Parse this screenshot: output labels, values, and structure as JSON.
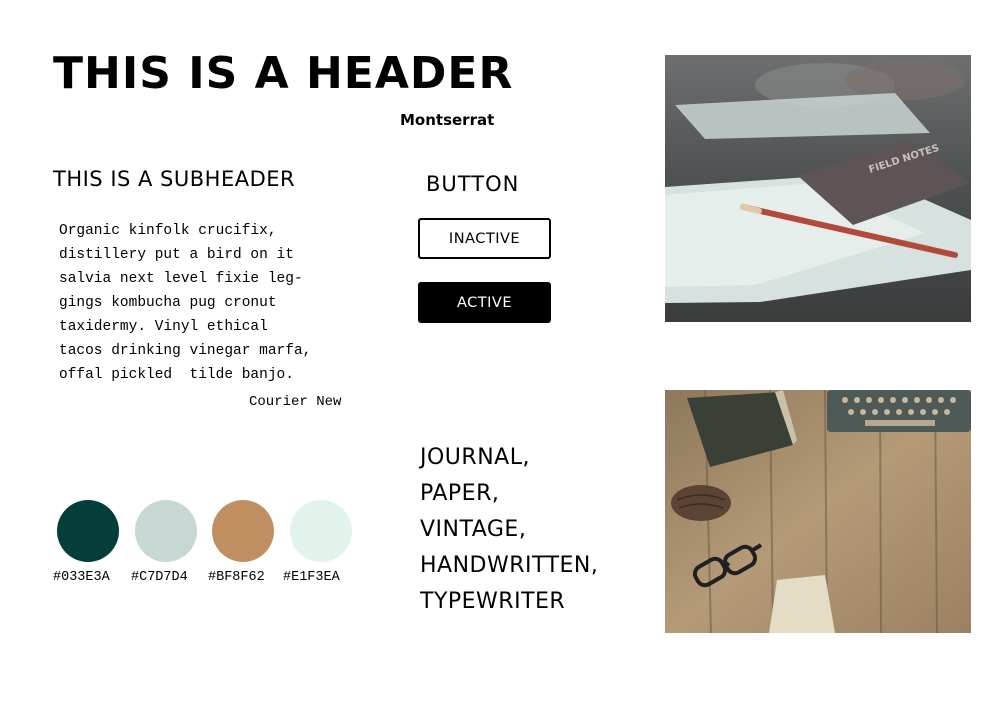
{
  "header": {
    "title": "THIS IS A HEADER",
    "font_name": "Montserrat"
  },
  "subheader": {
    "title": "THIS IS A SUBHEADER"
  },
  "body": {
    "lines": [
      "Organic kinfolk crucifix,",
      "distillery put a bird on it",
      "salvia next level fixie leg-",
      "gings kombucha pug cronut",
      "taxidermy. Vinyl ethical",
      "tacos drinking vinegar marfa,",
      "offal pickled  tilde banjo."
    ],
    "font_name": "Courier New"
  },
  "buttons": {
    "title": "BUTTON",
    "inactive_label": "INACTIVE",
    "active_label": "ACTIVE"
  },
  "keywords": [
    "JOURNAL,",
    "PAPER,",
    "VINTAGE,",
    "HANDWRITTEN,",
    "TYPEWRITER"
  ],
  "palette": [
    {
      "hex": "#033E3A",
      "label": "#033E3A"
    },
    {
      "hex": "#C7D7D4",
      "label": "#C7D7D4"
    },
    {
      "hex": "#BF8F62",
      "label": "#BF8F62"
    },
    {
      "hex": "#E1F3EA",
      "label": "#E1F3EA"
    }
  ],
  "photos": {
    "top_subject": "field-notes-notebook-pencil",
    "top_notebook_text": "FIELD NOTES",
    "bottom_subject": "typewriter-glasses-pinecone-on-wood"
  }
}
